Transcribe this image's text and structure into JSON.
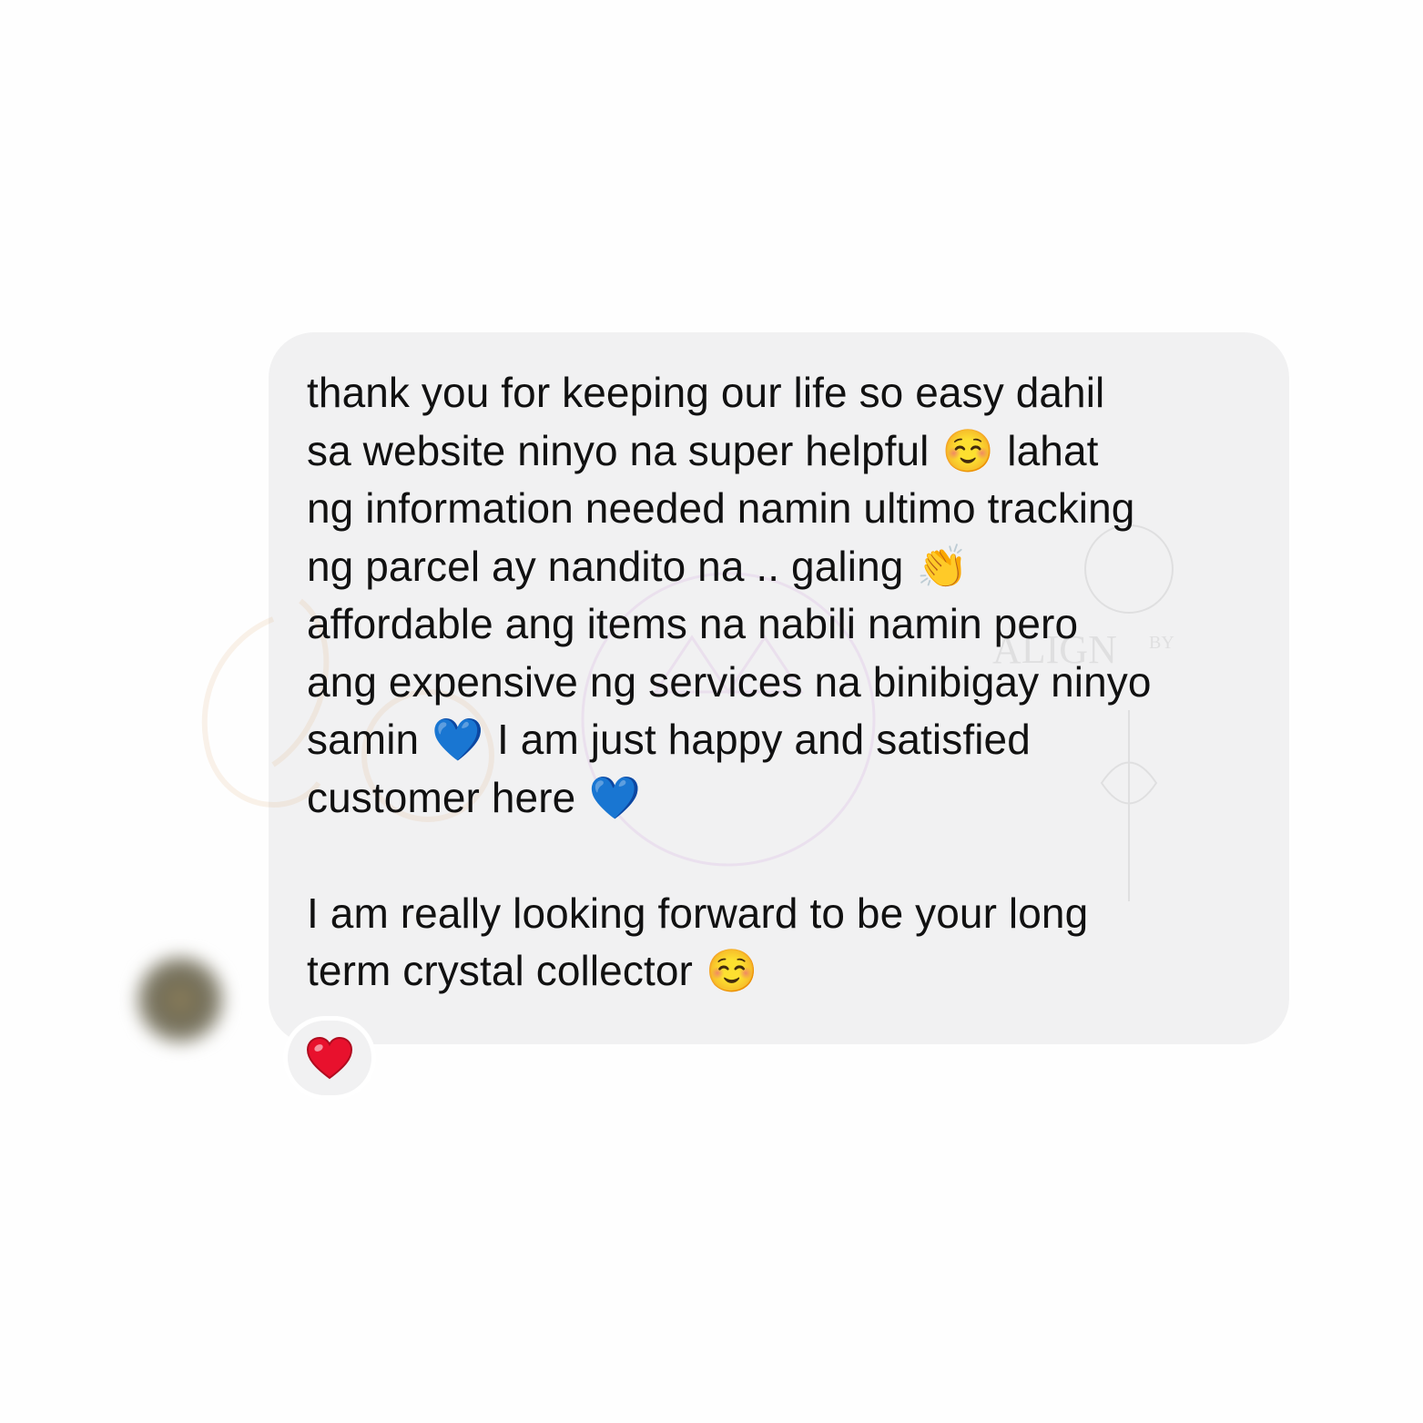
{
  "message": {
    "lines": [
      "thank you for keeping our life so easy dahil",
      "sa website ninyo na super helpful",
      "lahat",
      "ng information needed namin ultimo tracking",
      "ng parcel ay nandito na .. galing",
      "affordable ang items na nabili namin pero",
      "ang expensive ng services na binibigay ninyo",
      "samin",
      "I am just happy and satisfied",
      "customer here",
      "I am really looking forward to be your long",
      "term crystal collector"
    ],
    "emojis": {
      "smile": "☺️",
      "clap": "👏",
      "blue_heart": "💙"
    }
  },
  "reaction": {
    "emoji": "❤️",
    "icon": "red-heart-icon",
    "color": "#e8112d"
  },
  "watermark": {
    "text": "ALIGN",
    "sub": "BY"
  },
  "colors": {
    "bubble": "#f1f1f2",
    "text": "#111111",
    "blue_heart": "#1d5fe0",
    "smile": "#f7c531"
  }
}
